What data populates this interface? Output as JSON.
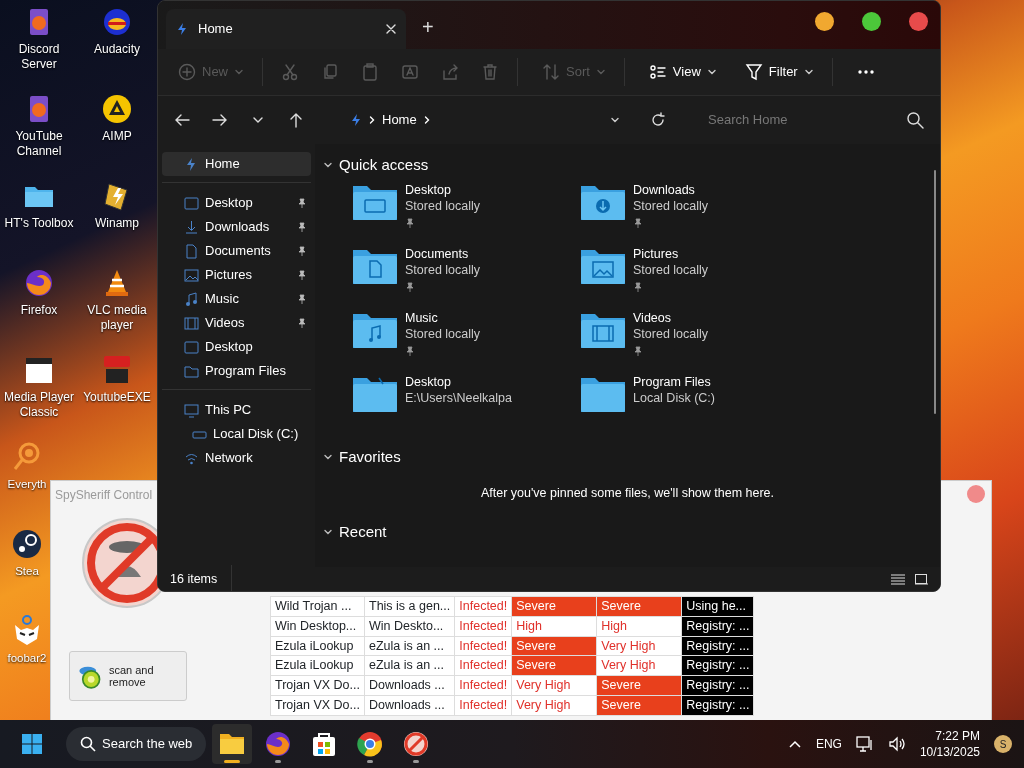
{
  "desktop_shortcuts": [
    {
      "label": "Discord Server"
    },
    {
      "label": "Audacity"
    },
    {
      "label": "YouTube Channel"
    },
    {
      "label": "AIMP"
    },
    {
      "label": "HT's Toolbox"
    },
    {
      "label": "Winamp"
    },
    {
      "label": "Firefox"
    },
    {
      "label": "VLC media player"
    },
    {
      "label": "Media Player Classic"
    },
    {
      "label": "YoutubeEXE"
    },
    {
      "label": "Everyth"
    },
    {
      "label": "Stea"
    },
    {
      "label": "foobar2"
    }
  ],
  "spysheriff": {
    "title": "SpySheriff Control",
    "scan_button": "scan and remove",
    "rows": [
      {
        "column_1": "Wild Trojan ...",
        "column_2": "This is a gen...",
        "column_3": "Infected!",
        "column_4": {
          "text": "Severe",
          "alert": true
        },
        "column_5": {
          "text": "Severe",
          "alert": true
        },
        "column_6": "Using he..."
      },
      {
        "column_1": "Win Desktop...",
        "column_2": "Win Deskto...",
        "column_3": "Infected!",
        "column_4": {
          "text": "High",
          "alert": false
        },
        "column_5": {
          "text": "High",
          "alert": false
        },
        "column_6": "Registry: ..."
      },
      {
        "column_1": "Ezula iLookup",
        "column_2": "eZula is an ...",
        "column_3": "Infected!",
        "column_4": {
          "text": "Severe",
          "alert": true
        },
        "column_5": {
          "text": "Very High",
          "alert": false
        },
        "column_6": "Registry: ..."
      },
      {
        "column_1": "Ezula iLookup",
        "column_2": "eZula is an ...",
        "column_3": "Infected!",
        "column_4": {
          "text": "Severe",
          "alert": true
        },
        "column_5": {
          "text": "Very High",
          "alert": false
        },
        "column_6": "Registry: ..."
      },
      {
        "column_1": "Trojan VX Do...",
        "column_2": "Downloads ...",
        "column_3": "Infected!",
        "column_4": {
          "text": "Very High",
          "alert": false
        },
        "column_5": {
          "text": "Severe",
          "alert": true
        },
        "column_6": "Registry: ..."
      },
      {
        "column_1": "Trojan VX Do...",
        "column_2": "Downloads ...",
        "column_3": "Infected!",
        "column_4": {
          "text": "Very High",
          "alert": false
        },
        "column_5": {
          "text": "Severe",
          "alert": true
        },
        "column_6": "Registry: ..."
      }
    ]
  },
  "explorer": {
    "window_controls": [
      {
        "color": "#f0a830"
      },
      {
        "color": "#4cc73a"
      },
      {
        "color": "#e84b4b"
      }
    ],
    "tabs": [
      {
        "label": "Home",
        "selected": true
      }
    ],
    "new_tab": "+",
    "toolbar": [
      {
        "label": "New",
        "disabled": true
      },
      {
        "disabled": true
      },
      {
        "disabled": true
      },
      {
        "disabled": true
      },
      {
        "disabled": true
      },
      {
        "disabled": true
      },
      {
        "disabled": true
      },
      {
        "label": "Sort",
        "disabled": true
      },
      {
        "label": "View",
        "disabled": false
      },
      {
        "label": "Filter",
        "disabled": false
      },
      {
        "disabled": false
      }
    ],
    "breadcrumb": [
      "Home"
    ],
    "search": {
      "placeholder": "Search Home"
    },
    "sidebar": [
      {
        "items": [
          {
            "label": "Home",
            "selected": true,
            "pinned": false
          }
        ]
      },
      {
        "items": [
          {
            "label": "Desktop",
            "selected": false,
            "pinned": true
          },
          {
            "label": "Downloads",
            "selected": false,
            "pinned": true
          },
          {
            "label": "Documents",
            "selected": false,
            "pinned": true
          },
          {
            "label": "Pictures",
            "selected": false,
            "pinned": true
          },
          {
            "label": "Music",
            "selected": false,
            "pinned": true
          },
          {
            "label": "Videos",
            "selected": false,
            "pinned": true
          },
          {
            "label": "Desktop",
            "selected": false,
            "pinned": false
          },
          {
            "label": "Program Files",
            "selected": false,
            "pinned": false
          }
        ]
      },
      {
        "items": [
          {
            "label": "This PC",
            "selected": false,
            "pinned": false,
            "children": [
              {
                "label": "Local Disk (C:)",
                "selected": false,
                "pinned": false
              }
            ]
          },
          {
            "label": "Network",
            "selected": false,
            "pinned": false
          }
        ]
      }
    ],
    "quick_access": {
      "heading": "Quick access",
      "items": [
        {
          "name": "Desktop",
          "detail": "Stored locally",
          "pinned": true
        },
        {
          "name": "Downloads",
          "detail": "Stored locally",
          "pinned": true
        },
        {
          "name": "Documents",
          "detail": "Stored locally",
          "pinned": true
        },
        {
          "name": "Pictures",
          "detail": "Stored locally",
          "pinned": true
        },
        {
          "name": "Music",
          "detail": "Stored locally",
          "pinned": true
        },
        {
          "name": "Videos",
          "detail": "Stored locally",
          "pinned": true
        },
        {
          "name": "Desktop",
          "detail": "E:\\Users\\Neelkalpa",
          "pinned": false
        },
        {
          "name": "Program Files",
          "detail": "Local Disk (C:)",
          "pinned": false
        }
      ]
    },
    "favorites": {
      "heading": "Favorites",
      "message": "After you've pinned some files, we'll show them here."
    },
    "recent": {
      "heading": "Recent"
    },
    "status_bar": {
      "count": "16 items"
    }
  },
  "taskbar": {
    "search": "Search the web",
    "apps": [
      {
        "active": true,
        "running": true
      },
      {
        "active": false,
        "running": true
      },
      {
        "active": false,
        "running": false
      },
      {
        "active": false,
        "running": true
      },
      {
        "active": false,
        "running": true
      }
    ],
    "language": "ENG",
    "time": "7:22 PM",
    "date": "10/13/2025",
    "avatar": "S"
  }
}
